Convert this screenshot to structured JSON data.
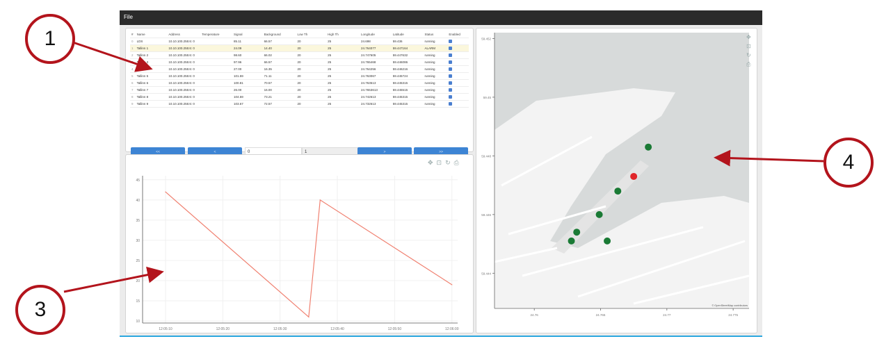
{
  "menubar": {
    "file_label": "File"
  },
  "table": {
    "headers": [
      "#",
      "Name",
      "Address",
      "Temperature",
      "Signal",
      "Background",
      "Low Th",
      "High Th",
      "Longitude",
      "Latitude",
      "Status",
      "Enabled"
    ],
    "rows": [
      [
        "0",
        "LDS",
        "10.10.100.255:6: 0",
        "",
        "85.11",
        "66.57",
        "20",
        "25",
        "24.698",
        "59.436",
        "running",
        ""
      ],
      [
        "1",
        "Tallinn 1",
        "10.10.100.255:6: 0",
        "",
        "24.09",
        "14.40",
        "20",
        "25",
        "24.764077",
        "59.447164",
        "ALARM",
        ""
      ],
      [
        "2",
        "Tallinn 2",
        "10.10.100.255:6: 0",
        "",
        "98.60",
        "66.02",
        "20",
        "25",
        "24.747605",
        "59.447632",
        "running",
        ""
      ],
      [
        "3",
        "Tallinn 3",
        "10.10.100.255:6: 0",
        "",
        "97.96",
        "66.57",
        "20",
        "25",
        "24.765468",
        "59.446086",
        "running",
        ""
      ],
      [
        "4",
        "Tallinn 4",
        "10.10.100.255:6: 0",
        "",
        "27.00",
        "16.35",
        "20",
        "25",
        "24.764256",
        "59.446216",
        "running",
        ""
      ],
      [
        "5",
        "Tallinn 5",
        "10.10.100.255:6: 0",
        "",
        "101.59",
        "71.11",
        "20",
        "25",
        "24.763067",
        "59.445724",
        "running",
        ""
      ],
      [
        "6",
        "Tallinn 6",
        "10.10.100.255:6: 0",
        "",
        "100.81",
        "70.57",
        "20",
        "25",
        "24.763513",
        "59.445315",
        "running",
        ""
      ],
      [
        "7",
        "Tallinn 7",
        "10.10.100.255:6: 0",
        "",
        "26.00",
        "16.00",
        "20",
        "25",
        "24.7653613",
        "59.445515",
        "running",
        ""
      ],
      [
        "8",
        "Tallinn 8",
        "10.10.100.255:6: 0",
        "",
        "104.59",
        "73.21",
        "20",
        "25",
        "24.742613",
        "59.445315",
        "running",
        ""
      ],
      [
        "9",
        "Tallinn 9",
        "10.10.100.255:6: 0",
        "",
        "103.67",
        "72.57",
        "20",
        "25",
        "24.732613",
        "59.445315",
        "running",
        ""
      ]
    ],
    "selected_row": 1
  },
  "pager": {
    "first_label": "<<",
    "prev_label": "<",
    "page_value": "0",
    "total_value": "1",
    "next_label": ">",
    "last_label": ">>"
  },
  "chart_toolbar": [
    "pan-icon",
    "box-zoom-icon",
    "reset-icon",
    "save-icon"
  ],
  "chart_data": {
    "type": "line",
    "x": [
      "12:05:10",
      "12:05:35",
      "12:05:37",
      "12:06:00"
    ],
    "values": [
      42,
      11,
      40,
      19
    ],
    "xticks": [
      "12:05:10",
      "12:05:20",
      "12:05:30",
      "12:05:40",
      "12:05:50",
      "12:06:00"
    ],
    "yticks": [
      "10",
      "15",
      "20",
      "25",
      "30",
      "35",
      "40",
      "45"
    ],
    "ylim": [
      9.5,
      46
    ],
    "grid": true,
    "line_color": "#f08070"
  },
  "map": {
    "yticks": [
      "59.452",
      "59.45",
      "59.448",
      "59.446",
      "59.444"
    ],
    "xticks": [
      "24.76",
      "24.765",
      "24.77",
      "24.775"
    ],
    "xlim": [
      24.757,
      24.7762
    ],
    "ylim": [
      59.4428,
      59.4522
    ],
    "attribution": "© OpenStreetMap contributors",
    "toolbar": [
      "pan-icon",
      "box-zoom-icon",
      "reset-icon",
      "save-icon"
    ],
    "sensors": [
      {
        "lon": 24.7686,
        "lat": 59.4483,
        "status": "running"
      },
      {
        "lon": 24.7675,
        "lat": 59.4473,
        "status": "alarm"
      },
      {
        "lon": 24.7663,
        "lat": 59.4468,
        "status": "running"
      },
      {
        "lon": 24.7649,
        "lat": 59.446,
        "status": "running"
      },
      {
        "lon": 24.7632,
        "lat": 59.4454,
        "status": "running"
      },
      {
        "lon": 24.7628,
        "lat": 59.4451,
        "status": "running"
      },
      {
        "lon": 24.7655,
        "lat": 59.4451,
        "status": "running"
      }
    ],
    "colors": {
      "running": "#1a7a35",
      "alarm": "#e0262a",
      "water": "#d7dada",
      "land": "#f3f3f3"
    }
  },
  "annotations": [
    "1",
    "3",
    "4"
  ]
}
